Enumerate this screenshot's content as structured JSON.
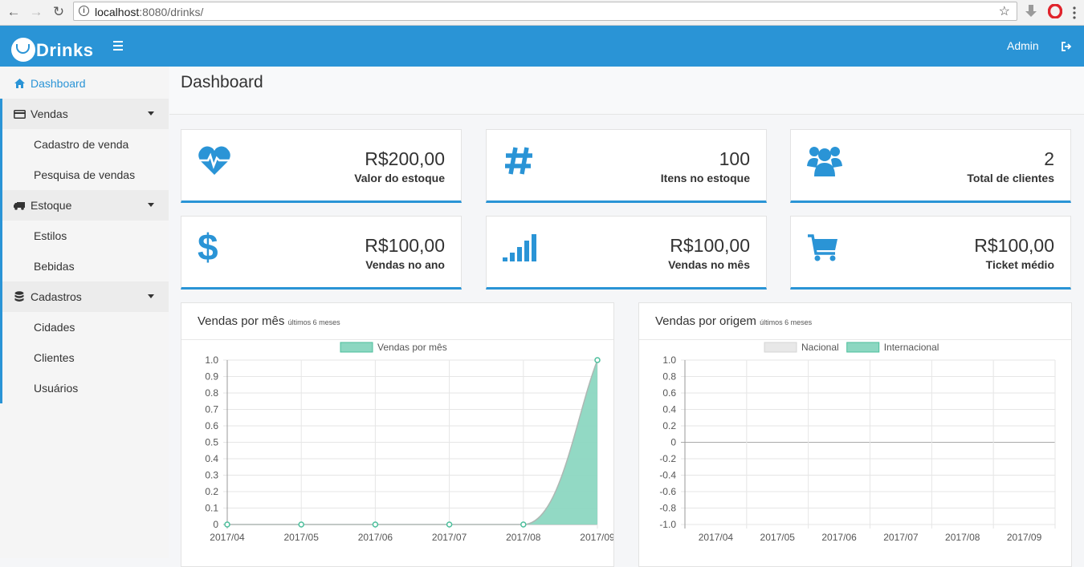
{
  "browser": {
    "url_host": "localhost",
    "url_rest": ":8080/drinks/"
  },
  "header": {
    "app_name": "Drinks",
    "user": "Admin"
  },
  "sidebar": {
    "dashboard": "Dashboard",
    "vendas": "Vendas",
    "cadastro_venda": "Cadastro de venda",
    "pesquisa_vendas": "Pesquisa de vendas",
    "estoque": "Estoque",
    "estilos": "Estilos",
    "bebidas": "Bebidas",
    "cadastros": "Cadastros",
    "cidades": "Cidades",
    "clientes": "Clientes",
    "usuarios": "Usuários"
  },
  "page": {
    "title": "Dashboard"
  },
  "stats": [
    {
      "value": "R$200,00",
      "label": "Valor do estoque",
      "icon": "heartbeat-icon"
    },
    {
      "value": "100",
      "label": "Itens no estoque",
      "icon": "hashtag-icon"
    },
    {
      "value": "2",
      "label": "Total de clientes",
      "icon": "users-icon"
    },
    {
      "value": "R$100,00",
      "label": "Vendas no ano",
      "icon": "dollar-icon"
    },
    {
      "value": "R$100,00",
      "label": "Vendas no mês",
      "icon": "signal-icon"
    },
    {
      "value": "R$100,00",
      "label": "Ticket médio",
      "icon": "shopping-cart-icon"
    }
  ],
  "panels": {
    "vendas_mes": {
      "title": "Vendas por mês",
      "subtitle": "últimos 6 meses"
    },
    "vendas_origem": {
      "title": "Vendas por origem",
      "subtitle": "últimos 6 meses"
    }
  },
  "colors": {
    "primary": "#2a94d6",
    "series_fill": "#8cd7c1",
    "series_line": "#4cbf9c",
    "nacional": "#e8e8e8"
  },
  "chart_data": [
    {
      "type": "area",
      "categories": [
        "2017/04",
        "2017/05",
        "2017/06",
        "2017/07",
        "2017/08",
        "2017/09"
      ],
      "series": [
        {
          "name": "Vendas por mês",
          "values": [
            0,
            0,
            0,
            0,
            0,
            1
          ]
        }
      ],
      "yticks": [
        "1.0",
        "0.9",
        "0.8",
        "0.7",
        "0.6",
        "0.5",
        "0.4",
        "0.3",
        "0.2",
        "0.1",
        "0"
      ],
      "ylim": [
        0,
        1
      ],
      "legend": "top",
      "grid": true
    },
    {
      "type": "bar",
      "categories": [
        "2017/04",
        "2017/05",
        "2017/06",
        "2017/07",
        "2017/08",
        "2017/09"
      ],
      "series": [
        {
          "name": "Nacional",
          "values": [
            0,
            0,
            0,
            0,
            0,
            0
          ]
        },
        {
          "name": "Internacional",
          "values": [
            0,
            0,
            0,
            0,
            0,
            0
          ]
        }
      ],
      "yticks": [
        "1.0",
        "0.8",
        "0.6",
        "0.4",
        "0.2",
        "0",
        "-0.2",
        "-0.4",
        "-0.6",
        "-0.8",
        "-1.0"
      ],
      "ylim": [
        -1,
        1
      ],
      "legend": "top",
      "grid": true
    }
  ]
}
